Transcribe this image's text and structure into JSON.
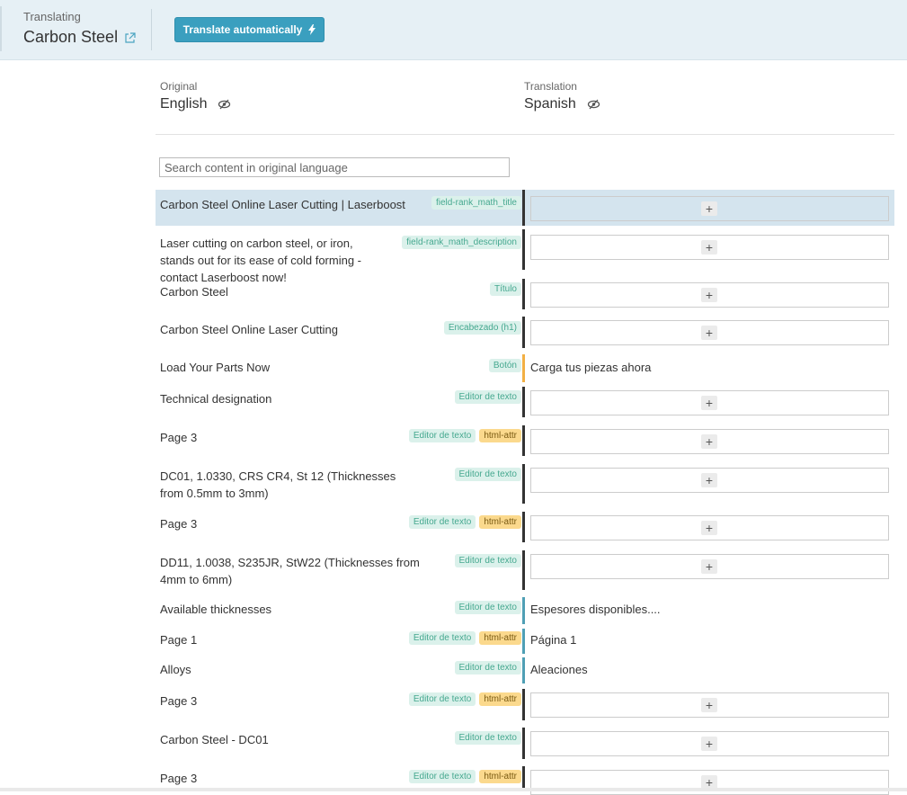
{
  "header": {
    "translating_label": "Translating",
    "title": "Carbon Steel",
    "auto_button": "Translate automatically"
  },
  "columns": {
    "original": {
      "label": "Original",
      "language": "English"
    },
    "translation": {
      "label": "Translation",
      "language": "Spanish"
    }
  },
  "search": {
    "placeholder": "Search content in original language",
    "value": ""
  },
  "rows": [
    {
      "source": "Carbon Steel Online Laser Cutting | Laserboost",
      "tags": [
        "field-rank_math_title"
      ],
      "html_attr": false,
      "translation": ""
    },
    {
      "source": "Laser cutting on carbon steel, or iron, stands out for its ease of cold forming - contact Laserboost now!",
      "tags": [
        "field-rank_math_description"
      ],
      "html_attr": false,
      "translation": ""
    },
    {
      "source": "Carbon Steel",
      "tags": [
        "Título"
      ],
      "html_attr": false,
      "translation": ""
    },
    {
      "source": "Carbon Steel Online Laser Cutting",
      "tags": [
        "Encabezado (h1)"
      ],
      "html_attr": false,
      "translation": ""
    },
    {
      "source": "Load Your Parts Now",
      "tags": [
        "Botón"
      ],
      "html_attr": false,
      "translation": "Carga tus piezas ahora"
    },
    {
      "source": "Technical designation",
      "tags": [
        "Editor de texto"
      ],
      "html_attr": false,
      "translation": ""
    },
    {
      "source": "Page 3",
      "tags": [
        "Editor de texto"
      ],
      "html_attr": true,
      "translation": ""
    },
    {
      "source": "DC01, 1.0330, CRS CR4, St 12 (Thicknesses from 0.5mm to 3mm)",
      "tags": [
        "Editor de texto"
      ],
      "html_attr": false,
      "translation": ""
    },
    {
      "source": "Page 3",
      "tags": [
        "Editor de texto"
      ],
      "html_attr": true,
      "translation": ""
    },
    {
      "source": "DD11, 1.0038, S235JR, StW22 (Thicknesses from 4mm to 6mm)",
      "tags": [
        "Editor de texto"
      ],
      "html_attr": false,
      "translation": ""
    },
    {
      "source": "Available thicknesses",
      "tags": [
        "Editor de texto"
      ],
      "html_attr": false,
      "translation": "Espesores disponibles...."
    },
    {
      "source": "Page 1",
      "tags": [
        "Editor de texto"
      ],
      "html_attr": true,
      "translation": "Página 1"
    },
    {
      "source": "Alloys",
      "tags": [
        "Editor de texto"
      ],
      "html_attr": false,
      "translation": "Aleaciones"
    },
    {
      "source": "Page 3",
      "tags": [
        "Editor de texto"
      ],
      "html_attr": true,
      "translation": ""
    },
    {
      "source": "Carbon Steel - DC01",
      "tags": [
        "Editor de texto"
      ],
      "html_attr": false,
      "translation": ""
    },
    {
      "source": "Page 3",
      "tags": [
        "Editor de texto"
      ],
      "html_attr": true,
      "translation": ""
    }
  ],
  "html_attr_label": "html-attr",
  "add_symbol": "+",
  "colors": {
    "header_bg": "#e6f0f5",
    "accent_button": "#3a9fbf",
    "highlight_row": "#d4e4ee",
    "tag_green_bg": "#dbf1eb",
    "tag_orange_bg": "#fbd98d",
    "status_untranslated": "#333333",
    "status_needs_review": "#f2b044",
    "status_translated": "#4f9fb5"
  },
  "icons": {
    "external_link": "external-link-icon",
    "auto_translate": "lightning-icon",
    "visibility": "eye-slash-icon"
  }
}
